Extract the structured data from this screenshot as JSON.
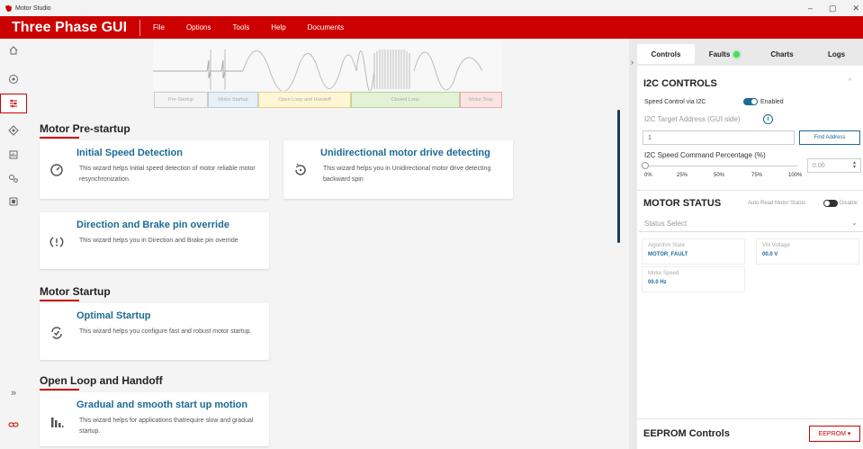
{
  "window": {
    "title": "Motor Studio",
    "minimize": "–",
    "maximize": "▢",
    "close": "✕"
  },
  "menubar": {
    "app_title": "Three Phase GUI",
    "items": [
      "File",
      "Options",
      "Tools",
      "Help",
      "Documents"
    ]
  },
  "colors": {
    "brand": "#cc0000",
    "accent": "#1c6b96",
    "fault_indicator": "#4cd964"
  },
  "leftnav": {
    "icons": [
      "home-icon",
      "compass-icon",
      "sliders-icon",
      "settings-alt-icon",
      "register-icon",
      "gears-icon",
      "chip-icon"
    ],
    "bottom_icons": [
      "collapse-icon",
      "link-icon"
    ],
    "collapse_label": "»"
  },
  "phases": [
    "Pre-Startup",
    "Motor Startup",
    "Open Loop and Handoff",
    "Closed Loop",
    "Motor Stop"
  ],
  "sections": {
    "prestartup": "Motor Pre-startup",
    "startup": "Motor Startup",
    "openloop": "Open Loop and Handoff"
  },
  "cards": [
    {
      "title": "Initial Speed Detection",
      "desc": "This wizard helps Initial speed detection of motor reliable motor resynchronization.",
      "icon": "speedometer-icon"
    },
    {
      "title": "Unidirectional motor drive detecting",
      "desc": "This wizard helps you in Unidirectional motor drive detecting backward spin",
      "icon": "rotate-icon"
    },
    {
      "title": "Direction and Brake pin override",
      "desc": "This wizard helps you in Direction and Brake pin override",
      "icon": "direction-brake-icon"
    },
    {
      "title": "Optimal Startup",
      "desc": "This wizard helps you configure fast and robust motor startup.",
      "icon": "refresh-check-icon"
    },
    {
      "title": "Gradual and smooth start up motion",
      "desc": "This wizard helps for applications thatrequire slow and gradual startup.",
      "icon": "bars-icon"
    }
  ],
  "rightpanel": {
    "expand_arrow": "›",
    "tabs": [
      "Controls",
      "Faults",
      "Charts",
      "Logs"
    ],
    "i2c": {
      "header": "I2C CONTROLS",
      "speed_control_label": "Speed Control via I2C",
      "speed_control_state": "Enabled",
      "target_address_label": "I2C Target Address (GUI side)",
      "target_address_value": "1",
      "find_address": "Find Address",
      "speed_cmd_label": "I2C Speed Command Percentage (%)",
      "slider_ticks": [
        "0%",
        "25%",
        "50%",
        "75%",
        "100%"
      ],
      "slider_value": 0,
      "speed_cmd_value": "0.00",
      "collapse_icon": "^"
    },
    "motor_status": {
      "header": "MOTOR STATUS",
      "auto_read_label": "Auto Read Motor Status",
      "auto_read_state": "Disable",
      "status_select_placeholder": "Status Select",
      "tiles": [
        {
          "label": "Algorithm State",
          "value": "MOTOR_FAULT"
        },
        {
          "label": "VM Voltage",
          "value": "00.0 V"
        },
        {
          "label": "Motor Speed",
          "value": "00.0 Hz"
        }
      ]
    },
    "eeprom": {
      "header": "EEPROM Controls",
      "button": "EEPROM ▾"
    }
  }
}
